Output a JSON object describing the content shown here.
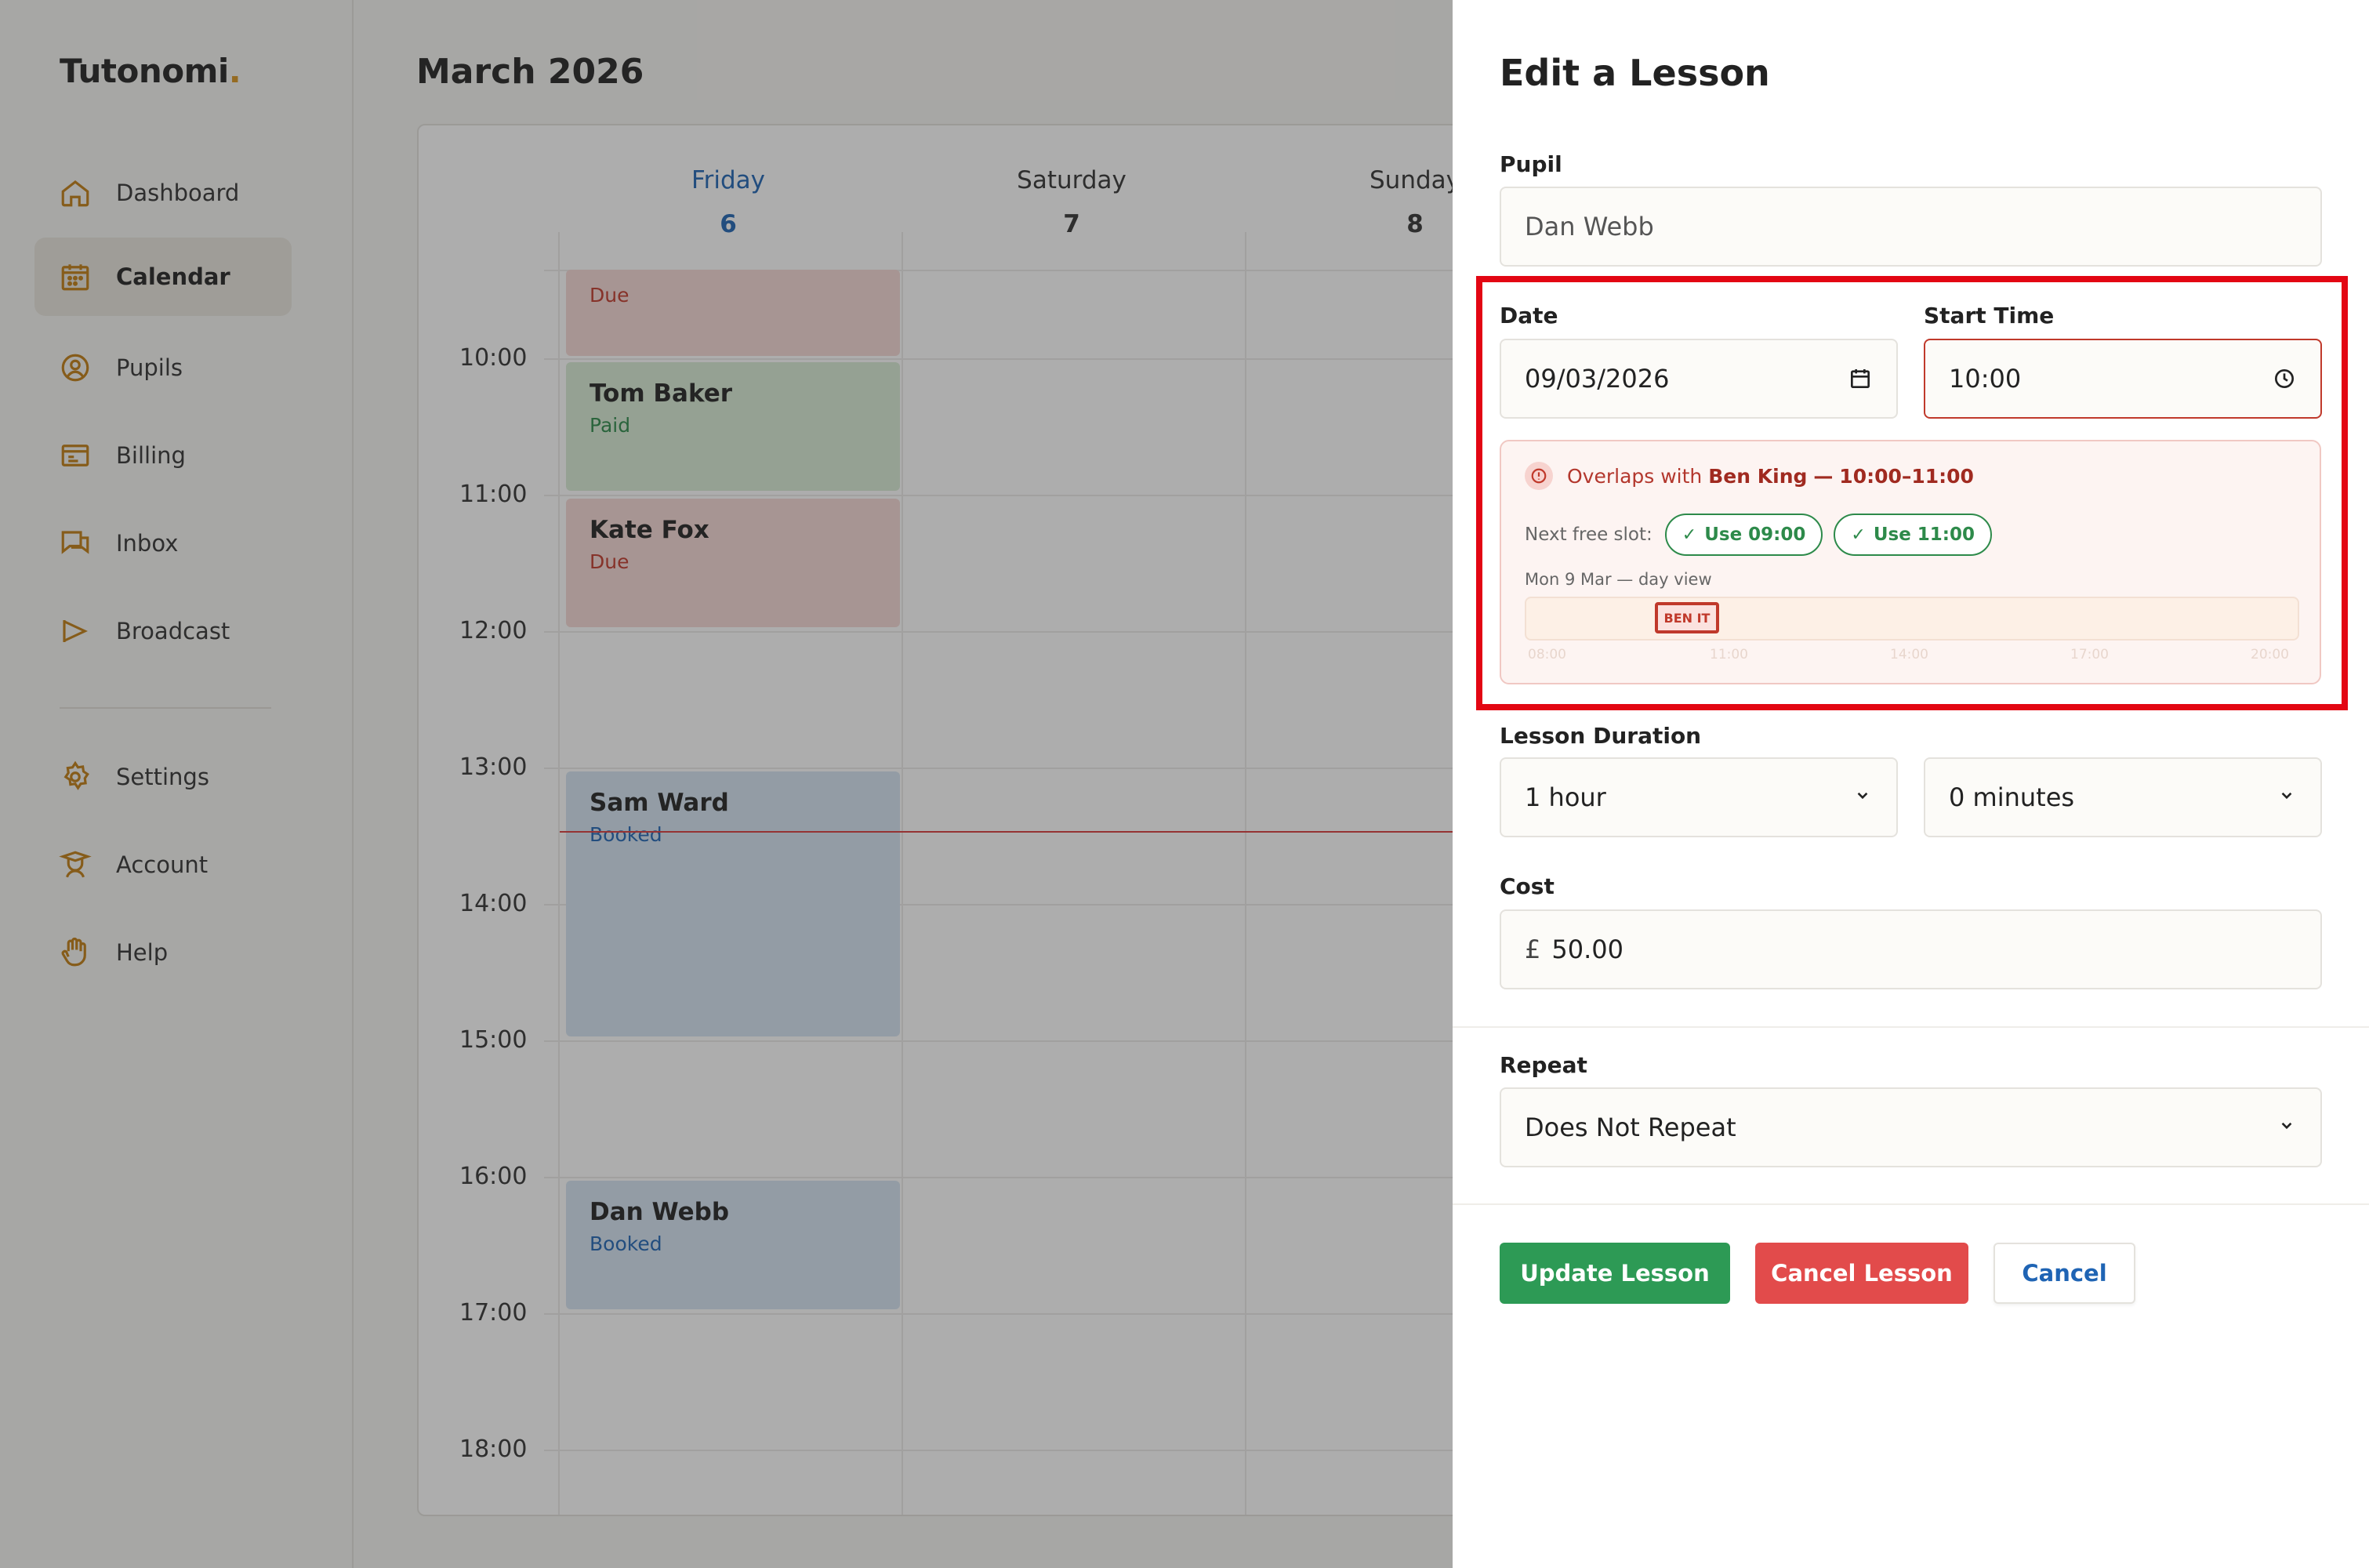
{
  "app": {
    "logo_text": "Tutonomi",
    "logo_dot": ".",
    "month_title": "March 2026"
  },
  "sidebar": {
    "items": [
      {
        "label": "Dashboard",
        "icon": "home-icon"
      },
      {
        "label": "Calendar",
        "icon": "calendar-icon",
        "active": true
      },
      {
        "label": "Pupils",
        "icon": "user-circle-icon"
      },
      {
        "label": "Billing",
        "icon": "billing-icon"
      },
      {
        "label": "Inbox",
        "icon": "chat-icon"
      },
      {
        "label": "Broadcast",
        "icon": "megaphone-icon"
      },
      {
        "label": "Settings",
        "icon": "gear-icon"
      },
      {
        "label": "Account",
        "icon": "account-icon"
      },
      {
        "label": "Help",
        "icon": "help-hand-icon"
      }
    ]
  },
  "calendar": {
    "days": [
      {
        "name": "Friday",
        "num": "6",
        "today": true
      },
      {
        "name": "Saturday",
        "num": "7"
      },
      {
        "name": "Sunday",
        "num": "8"
      }
    ],
    "times": [
      "10:00",
      "11:00",
      "12:00",
      "13:00",
      "14:00",
      "15:00",
      "16:00",
      "17:00",
      "18:00"
    ],
    "events": [
      {
        "name": "",
        "status": "Due",
        "kind": "due"
      },
      {
        "name": "Tom Baker",
        "status": "Paid",
        "kind": "paid"
      },
      {
        "name": "Kate Fox",
        "status": "Due",
        "kind": "due"
      },
      {
        "name": "Sam Ward",
        "status": "Booked",
        "kind": "booked"
      },
      {
        "name": "Dan Webb",
        "status": "Booked",
        "kind": "booked"
      }
    ]
  },
  "drawer": {
    "title": "Edit a Lesson",
    "pupil_label": "Pupil",
    "pupil_value": "Dan Webb",
    "date_label": "Date",
    "date_value": "09/03/2026",
    "start_label": "Start Time",
    "start_value": "10:00",
    "conflict": {
      "prefix": "Overlaps with",
      "who": "Ben King",
      "dash": "—",
      "range": "10:00–11:00",
      "next_label": "Next free slot:",
      "slot_1": "Use 09:00",
      "slot_2": "Use 11:00",
      "dayview_label": "Mon 9 Mar — day view",
      "block_label": "BEN IT",
      "ticks": [
        "08:00",
        "11:00",
        "14:00",
        "17:00",
        "20:00"
      ]
    },
    "duration_label": "Lesson Duration",
    "duration_hours": "1 hour",
    "duration_minutes": "0 minutes",
    "cost_label": "Cost",
    "cost_currency": "£",
    "cost_value": "50.00",
    "repeat_label": "Repeat",
    "repeat_value": "Does Not Repeat",
    "btn_update": "Update Lesson",
    "btn_cancel_lesson": "Cancel Lesson",
    "btn_cancel": "Cancel"
  },
  "colors": {
    "accent_blue": "#1f64b4",
    "success_green": "#2d9a55",
    "danger_red": "#e24b4b",
    "highlight_red": "#e30613"
  }
}
